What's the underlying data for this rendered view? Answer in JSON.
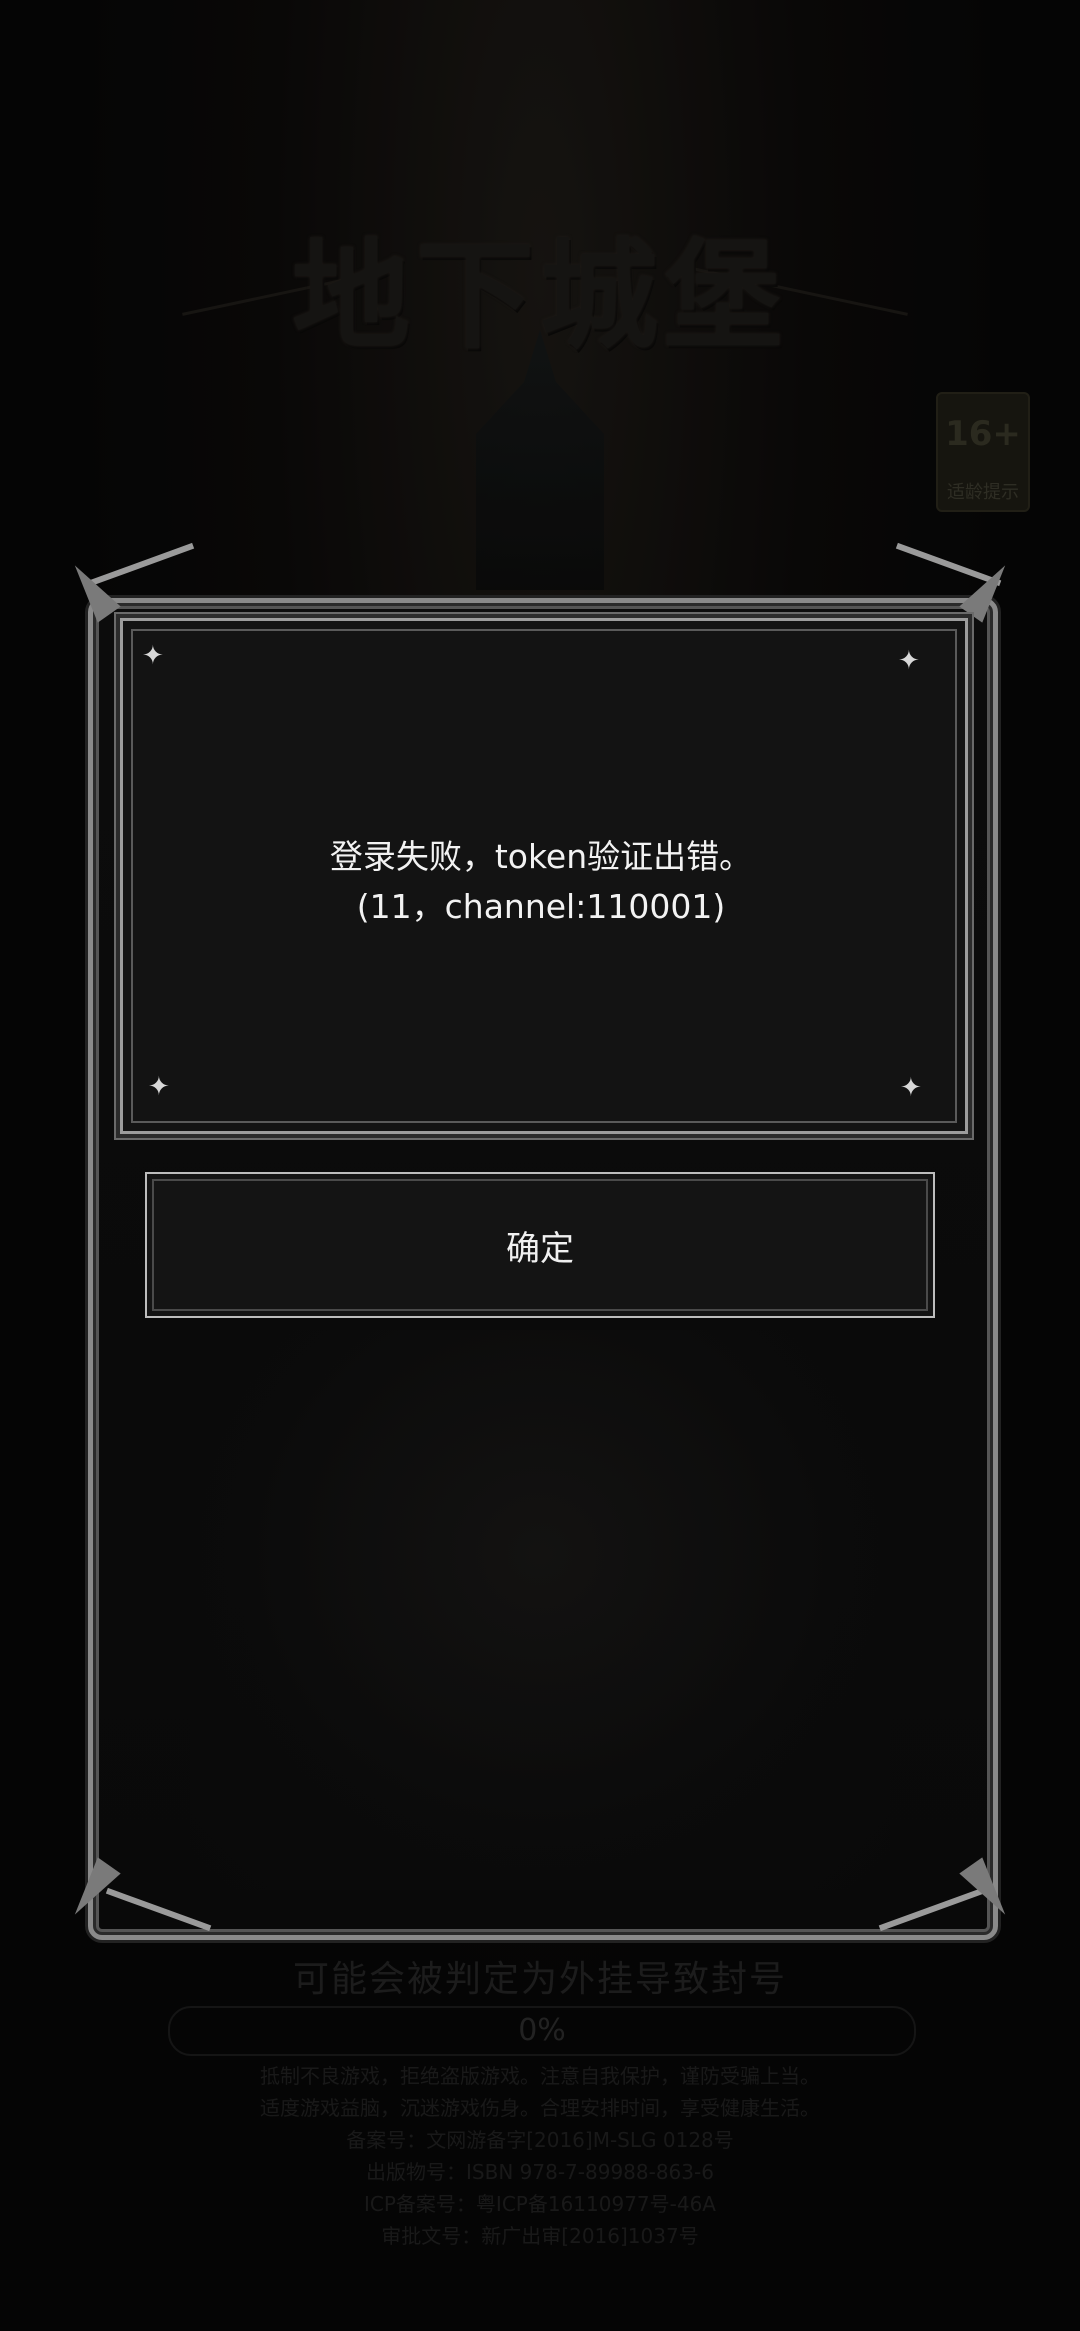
{
  "background": {
    "logo": "地下城堡",
    "age_badge": {
      "number": "16+",
      "label": "适龄提示"
    },
    "warning": "可能会被判定为外挂导致封号",
    "progress": {
      "text": "0%",
      "value": 0
    },
    "notices": [
      "抵制不良游戏，拒绝盗版游戏。注意自我保护，谨防受骗上当。",
      "适度游戏益脑，沉迷游戏伤身。合理安排时间，享受健康生活。",
      "备案号：文网游备字[2016]M-SLG 0128号",
      "出版物号：ISBN 978-7-89988-863-6",
      "ICP备案号：粤ICP备16110977号-46A",
      "审批文号：新广出审[2016]1037号"
    ]
  },
  "dialog": {
    "message_line1": "登录失败，token验证出错。",
    "message_line2": "(11，channel:110001)",
    "confirm_label": "确定"
  }
}
